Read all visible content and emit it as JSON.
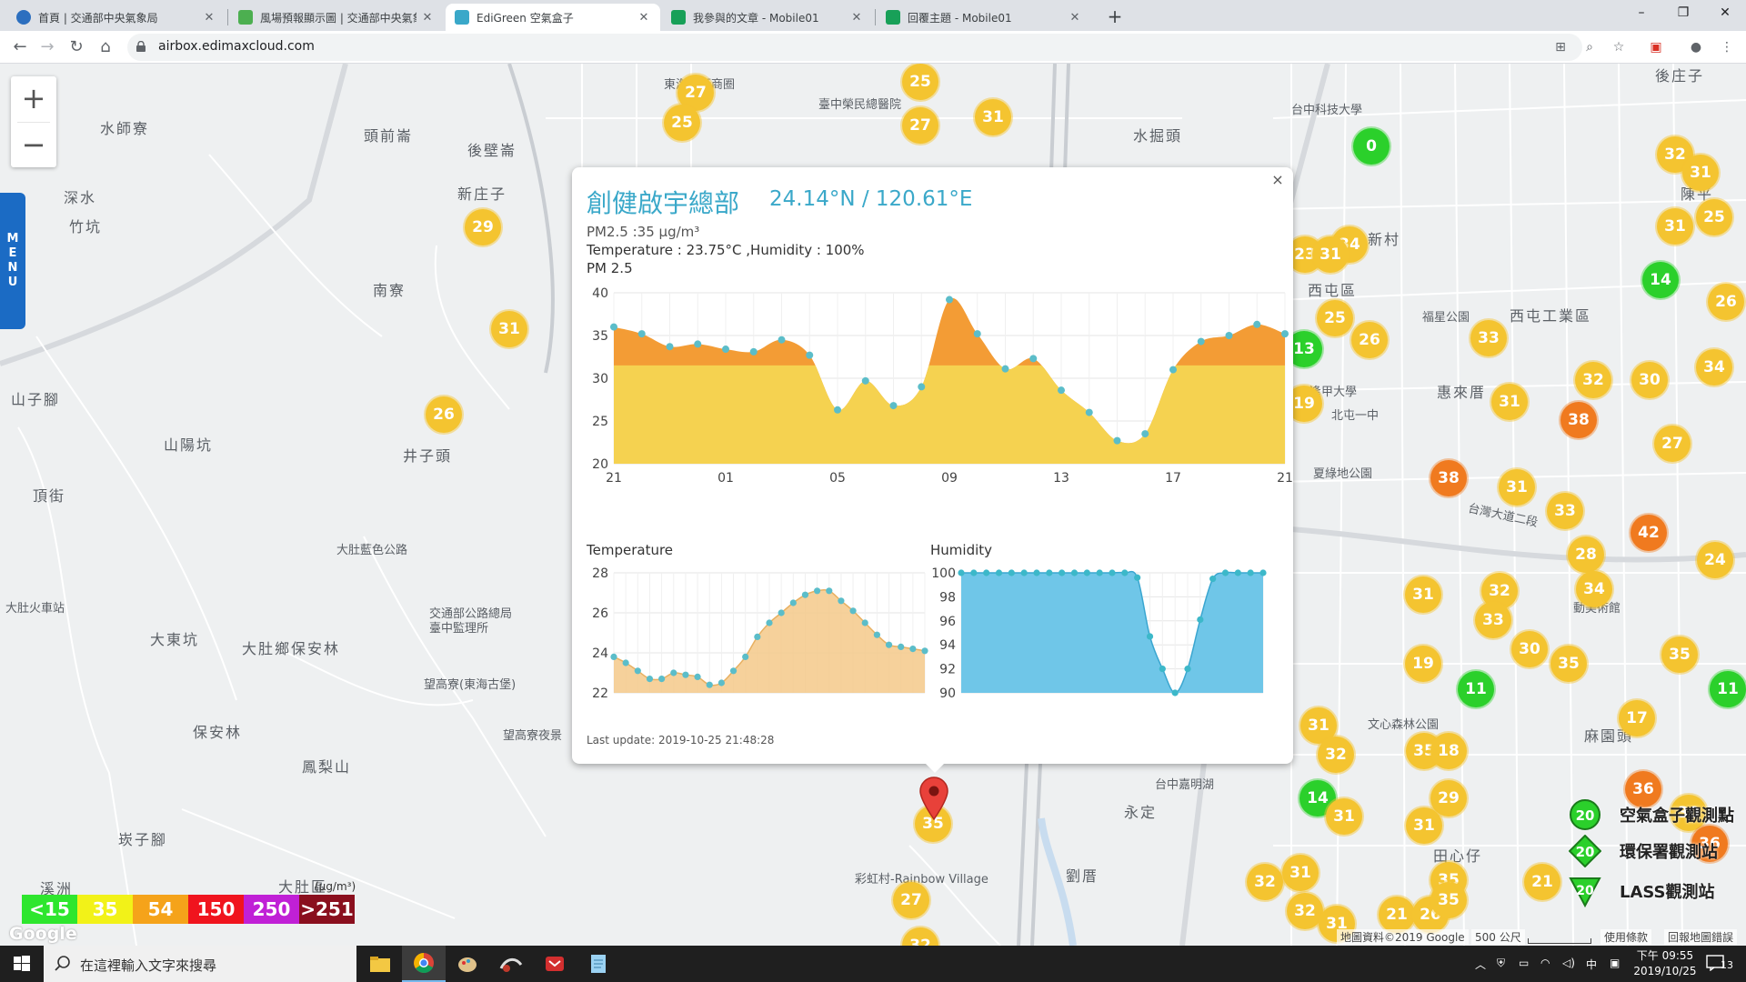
{
  "browser": {
    "tabs": [
      {
        "title": "首頁 | 交通部中央氣象局",
        "favicon_color": "#2c6fbf",
        "active": false
      },
      {
        "title": "風場預報顯示圖 | 交通部中央氣象",
        "favicon_color": "#4caf50",
        "active": false
      },
      {
        "title": "EdiGreen 空氣盒子",
        "favicon_color": "#3aa8c9",
        "active": true
      },
      {
        "title": "我參與的文章 - Mobile01",
        "favicon_color": "#18a058",
        "active": false
      },
      {
        "title": "回覆主題 - Mobile01",
        "favicon_color": "#18a058",
        "active": false
      }
    ],
    "url": "airbox.edimaxcloud.com",
    "window_controls": {
      "minimize": "–",
      "restore": "❐",
      "close": "✕"
    }
  },
  "map": {
    "zoom_in": "+",
    "zoom_out": "−",
    "menu_label": [
      "M",
      "E",
      "N",
      "U"
    ],
    "place_names": [
      {
        "text": "東海別街商圈"
      },
      {
        "text": "水師寮"
      },
      {
        "text": "頭前崙"
      },
      {
        "text": "後壁崙"
      },
      {
        "text": "水掘頭"
      },
      {
        "text": "深水"
      },
      {
        "text": "竹坑"
      },
      {
        "text": "新庄子"
      },
      {
        "text": "南寮"
      },
      {
        "text": "山子腳"
      },
      {
        "text": "山陽坑"
      },
      {
        "text": "井子頭"
      },
      {
        "text": "頂街"
      },
      {
        "text": "大肚藍色公路"
      },
      {
        "text": "大東坑"
      },
      {
        "text": "大肚鄉保安林"
      },
      {
        "text": "交通部公路總局\n臺中監理所"
      },
      {
        "text": "望高寮(東海古堡)"
      },
      {
        "text": "保安林"
      },
      {
        "text": "望高寮夜景"
      },
      {
        "text": "鳳梨山"
      },
      {
        "text": "崁子腳"
      },
      {
        "text": "溪洲"
      },
      {
        "text": "大肚區"
      },
      {
        "text": "永定"
      },
      {
        "text": "劉厝"
      },
      {
        "text": "彩虹村-Rainbow Village"
      },
      {
        "text": "西屯區"
      },
      {
        "text": "新村"
      },
      {
        "text": "惠來厝"
      },
      {
        "text": "西屯工業區"
      },
      {
        "text": "福星公園"
      },
      {
        "text": "麻園頭"
      },
      {
        "text": "田心仔"
      },
      {
        "text": "台中嘉明湖"
      },
      {
        "text": "後庄子"
      },
      {
        "text": "陳平"
      },
      {
        "text": "大肚火車站"
      },
      {
        "text": "台灣大道二段"
      },
      {
        "text": "文心森林公園"
      },
      {
        "text": "動美術館"
      },
      {
        "text": "夏綠地公園"
      },
      {
        "text": "逢甲大學"
      },
      {
        "text": "北屯一中"
      },
      {
        "text": "臺中榮民總醫院"
      },
      {
        "text": "台中科技大學"
      }
    ],
    "markers": [
      {
        "v": "27",
        "c": "yellow"
      },
      {
        "v": "25",
        "c": "yellow"
      },
      {
        "v": "25",
        "c": "yellow"
      },
      {
        "v": "27",
        "c": "yellow"
      },
      {
        "v": "31",
        "c": "yellow"
      },
      {
        "v": "29",
        "c": "yellow"
      },
      {
        "v": "31",
        "c": "yellow"
      },
      {
        "v": "26",
        "c": "yellow"
      },
      {
        "v": "0",
        "c": "green"
      },
      {
        "v": "32",
        "c": "yellow"
      },
      {
        "v": "31",
        "c": "yellow"
      },
      {
        "v": "31",
        "c": "yellow"
      },
      {
        "v": "25",
        "c": "yellow"
      },
      {
        "v": "14",
        "c": "green"
      },
      {
        "v": "26",
        "c": "yellow"
      },
      {
        "v": "34",
        "c": "yellow"
      },
      {
        "v": "23",
        "c": "yellow"
      },
      {
        "v": "31",
        "c": "yellow"
      },
      {
        "v": "25",
        "c": "yellow"
      },
      {
        "v": "26",
        "c": "yellow"
      },
      {
        "v": "33",
        "c": "yellow"
      },
      {
        "v": "13",
        "c": "green"
      },
      {
        "v": "19",
        "c": "yellow"
      },
      {
        "v": "31",
        "c": "yellow"
      },
      {
        "v": "32",
        "c": "yellow"
      },
      {
        "v": "30",
        "c": "yellow"
      },
      {
        "v": "38",
        "c": "orange"
      },
      {
        "v": "34",
        "c": "yellow"
      },
      {
        "v": "27",
        "c": "yellow"
      },
      {
        "v": "38",
        "c": "orange"
      },
      {
        "v": "31",
        "c": "yellow"
      },
      {
        "v": "33",
        "c": "yellow"
      },
      {
        "v": "42",
        "c": "orange"
      },
      {
        "v": "28",
        "c": "yellow"
      },
      {
        "v": "24",
        "c": "yellow"
      },
      {
        "v": "31",
        "c": "yellow"
      },
      {
        "v": "32",
        "c": "yellow"
      },
      {
        "v": "34",
        "c": "yellow"
      },
      {
        "v": "33",
        "c": "yellow"
      },
      {
        "v": "30",
        "c": "yellow"
      },
      {
        "v": "35",
        "c": "yellow"
      },
      {
        "v": "19",
        "c": "yellow"
      },
      {
        "v": "35",
        "c": "yellow"
      },
      {
        "v": "11",
        "c": "green"
      },
      {
        "v": "11",
        "c": "green"
      },
      {
        "v": "31",
        "c": "yellow"
      },
      {
        "v": "32",
        "c": "yellow"
      },
      {
        "v": "35",
        "c": "yellow"
      },
      {
        "v": "18",
        "c": "yellow"
      },
      {
        "v": "17",
        "c": "yellow"
      },
      {
        "v": "36",
        "c": "orange"
      },
      {
        "v": "14",
        "c": "green"
      },
      {
        "v": "31",
        "c": "yellow"
      },
      {
        "v": "29",
        "c": "yellow"
      },
      {
        "v": "31",
        "c": "yellow"
      },
      {
        "v": "30",
        "c": "yellow"
      },
      {
        "v": "36",
        "c": "orange"
      },
      {
        "v": "35",
        "c": "yellow"
      },
      {
        "v": "27",
        "c": "yellow"
      },
      {
        "v": "32",
        "c": "yellow"
      },
      {
        "v": "31",
        "c": "yellow"
      },
      {
        "v": "32",
        "c": "yellow"
      },
      {
        "v": "31",
        "c": "yellow"
      },
      {
        "v": "21",
        "c": "yellow"
      },
      {
        "v": "26",
        "c": "yellow"
      },
      {
        "v": "35",
        "c": "yellow"
      },
      {
        "v": "21",
        "c": "yellow"
      },
      {
        "v": "32",
        "c": "yellow"
      }
    ],
    "selected_marker": "35",
    "legend": [
      {
        "label": "<15",
        "color": "#2ee62e"
      },
      {
        "label": "35",
        "color": "#f2f218"
      },
      {
        "label": "54",
        "color": "#f5a31a"
      },
      {
        "label": "150",
        "color": "#f0141e"
      },
      {
        "label": "250",
        "color": "#c020d6"
      },
      {
        "label": ">251",
        "color": "#8a0f1e"
      }
    ],
    "legend_unit": "(μg/m³)",
    "google_logo": "Google",
    "station_types": [
      {
        "label": "空氣盒子觀測點",
        "value": "20"
      },
      {
        "label": "環保署觀測站",
        "value": "20"
      },
      {
        "label": "LASS觀測站",
        "value": "20"
      }
    ],
    "attribution": "地圖資料©2019 Google",
    "scale_label": "500 公尺",
    "terms": "使用條款",
    "report": "回報地圖錯誤"
  },
  "popup": {
    "close_label": "×",
    "station_name": "創健啟宇總部",
    "coordinates": "24.14°N / 120.61°E",
    "pm25_line": "PM2.5 :35 μg/m³",
    "temp_hum_line": "Temperature : 23.75°C ,Humidity : 100%",
    "pm_chart_title": "PM 2.5",
    "temp_chart_title": "Temperature",
    "hum_chart_title": "Humidity",
    "last_update": "Last update: 2019-10-25 21:48:28"
  },
  "chart_data": [
    {
      "type": "area",
      "title": "PM 2.5",
      "x": [
        "21",
        "22",
        "23",
        "00",
        "01",
        "02",
        "03",
        "04",
        "05",
        "06",
        "07",
        "08",
        "09",
        "10",
        "11",
        "12",
        "13",
        "14",
        "15",
        "16",
        "17",
        "18",
        "19",
        "20",
        "21"
      ],
      "tick_labels": [
        "21",
        "01",
        "05",
        "09",
        "13",
        "17",
        "21"
      ],
      "series": [
        {
          "values": [
            36,
            35.2,
            33.7,
            34,
            33.4,
            33.1,
            34.5,
            32.7,
            26.3,
            29.7,
            26.8,
            29,
            39.2,
            35.2,
            31.1,
            32.3,
            28.6,
            26,
            22.7,
            23.5,
            31,
            34.3,
            35,
            36.3,
            35.2
          ]
        }
      ],
      "ylim": [
        20,
        40
      ],
      "yticks": [
        20,
        25,
        30,
        35,
        40
      ],
      "threshold": 31.5,
      "colors": {
        "below": "#f5d250",
        "above": "#f39c35",
        "point": "#5bbdc9"
      }
    },
    {
      "type": "area",
      "title": "Temperature",
      "series": [
        {
          "values": [
            23.8,
            23.5,
            23.1,
            22.7,
            22.7,
            23,
            22.9,
            22.8,
            22.4,
            22.5,
            23.1,
            23.8,
            24.8,
            25.5,
            26,
            26.5,
            26.9,
            27.1,
            27.1,
            26.6,
            26.1,
            25.5,
            24.9,
            24.4,
            24.3,
            24.2,
            24.1
          ]
        }
      ],
      "ylim": [
        22,
        28
      ],
      "yticks": [
        22,
        24,
        26,
        28
      ],
      "colors": {
        "fill": "#f5c98a",
        "point": "#5bbdc9"
      }
    },
    {
      "type": "area",
      "title": "Humidity",
      "series": [
        {
          "values": [
            100,
            100,
            100,
            100,
            100,
            100,
            100,
            100,
            100,
            100,
            100,
            100,
            100,
            100,
            99.6,
            94.7,
            92,
            90,
            92,
            96.1,
            99.5,
            100,
            100,
            100,
            100
          ]
        }
      ],
      "ylim": [
        90,
        100
      ],
      "yticks": [
        90,
        92,
        94,
        96,
        98,
        100
      ],
      "colors": {
        "fill": "#6fc6e8",
        "point": "#3cb8c9"
      }
    }
  ],
  "taskbar": {
    "search_placeholder": "在這裡輸入文字來搜尋",
    "ime": "中",
    "clock_time": "下午 09:55",
    "clock_date": "2019/10/25",
    "notifications": "13"
  }
}
